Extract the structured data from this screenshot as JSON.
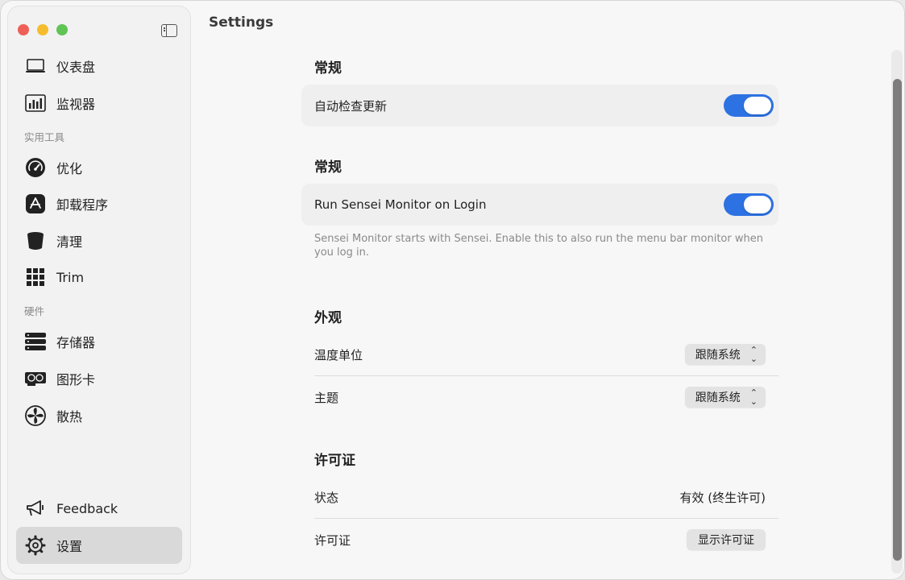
{
  "window": {
    "title": "Settings",
    "traffic_lights": {
      "close": "#ee5f57",
      "minimize": "#f5bd2e",
      "zoom": "#5fc454"
    }
  },
  "sidebar": {
    "items_top": [
      {
        "label": "仪表盘",
        "icon": "laptop-icon"
      },
      {
        "label": "监视器",
        "icon": "chart-icon"
      }
    ],
    "section_tools": "实用工具",
    "items_tools": [
      {
        "label": "优化",
        "icon": "gauge-icon"
      },
      {
        "label": "卸载程序",
        "icon": "app-store-icon"
      },
      {
        "label": "清理",
        "icon": "bin-icon"
      },
      {
        "label": "Trim",
        "icon": "grid-icon"
      }
    ],
    "section_hardware": "硬件",
    "items_hardware": [
      {
        "label": "存储器",
        "icon": "storage-icon"
      },
      {
        "label": "图形卡",
        "icon": "gpu-icon"
      },
      {
        "label": "散热",
        "icon": "fan-icon"
      }
    ],
    "items_bottom": [
      {
        "label": "Feedback",
        "icon": "megaphone-icon"
      },
      {
        "label": "设置",
        "icon": "gear-icon",
        "active": true
      }
    ]
  },
  "groups": {
    "general1": {
      "title": "常规",
      "auto_update_label": "自动检查更新",
      "auto_update_on": true
    },
    "general2": {
      "title": "常规",
      "run_on_login_label": "Run Sensei Monitor on Login",
      "run_on_login_on": true,
      "description": "Sensei Monitor starts with Sensei. Enable this to also run the menu bar monitor when you log in."
    },
    "appearance": {
      "title": "外观",
      "temp_unit_label": "温度单位",
      "temp_unit_value": "跟随系统",
      "theme_label": "主题",
      "theme_value": "跟随系统"
    },
    "license": {
      "title": "许可证",
      "status_label": "状态",
      "status_value": "有效 (终生许可)",
      "license_label": "许可证",
      "show_license_button": "显示许可证"
    }
  },
  "accent_color": "#2d72e3"
}
